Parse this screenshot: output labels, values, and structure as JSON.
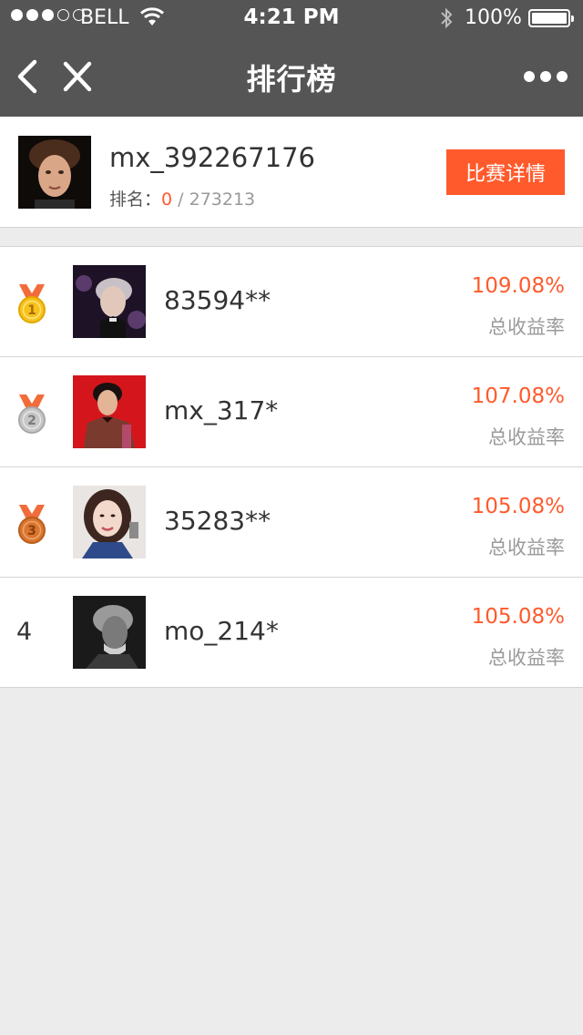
{
  "status_bar": {
    "carrier": "BELL",
    "time": "4:21 PM",
    "battery": "100%"
  },
  "nav": {
    "title": "排行榜"
  },
  "profile": {
    "username": "mx_392267176",
    "rank_label": "排名：",
    "rank_value": "0",
    "rank_separator": "/",
    "rank_total": "273213",
    "detail_button": "比赛详情"
  },
  "leaderboard": [
    {
      "rank": "1",
      "name": "83594**",
      "value": "109.08%",
      "label": "总收益率",
      "medal": "gold"
    },
    {
      "rank": "2",
      "name": "mx_317*",
      "value": "107.08%",
      "label": "总收益率",
      "medal": "silver"
    },
    {
      "rank": "3",
      "name": "35283**",
      "value": "105.08%",
      "label": "总收益率",
      "medal": "bronze"
    },
    {
      "rank": "4",
      "name": "mo_214*",
      "value": "105.08%",
      "label": "总收益率",
      "medal": ""
    }
  ],
  "colors": {
    "accent": "#ff5a2c",
    "header": "#555555",
    "background": "#ececec",
    "gold": "#f7c21a",
    "silver": "#c6c6c6",
    "bronze": "#d9762f"
  }
}
